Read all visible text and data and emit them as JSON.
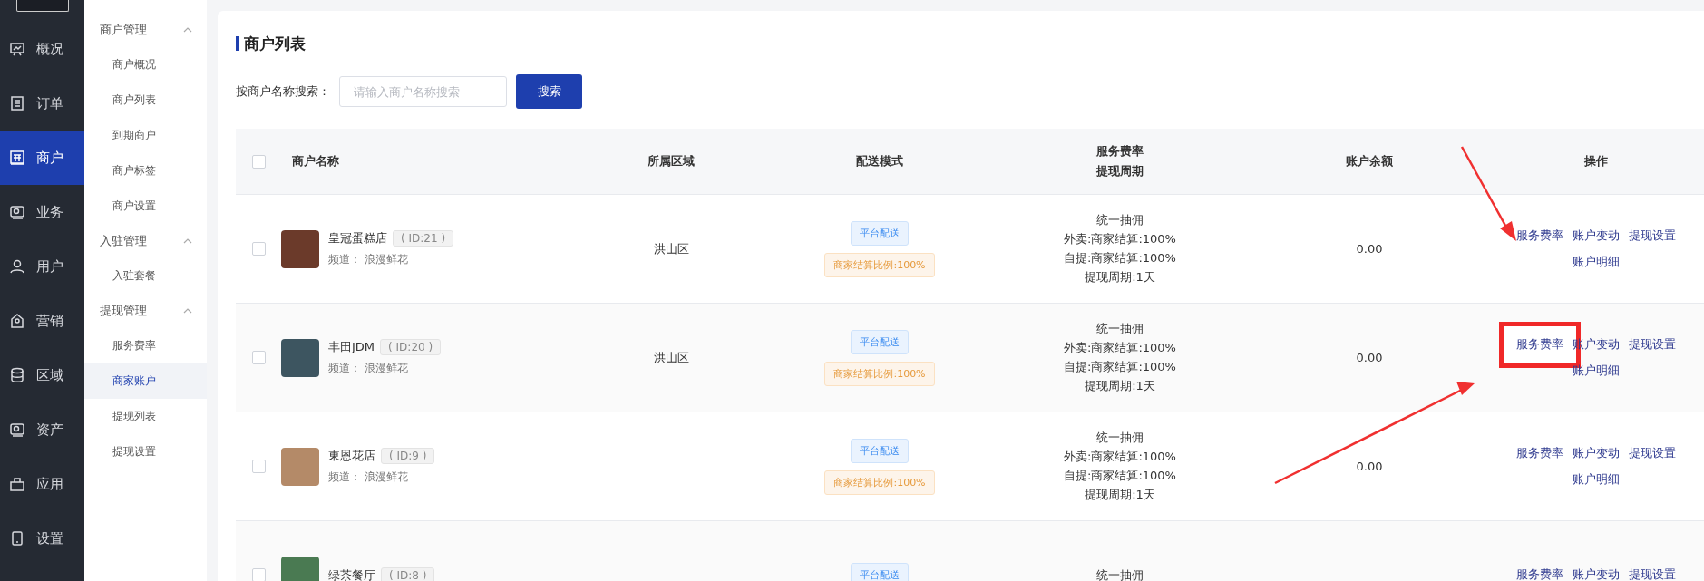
{
  "main_nav": [
    {
      "label": "概况",
      "selected": false
    },
    {
      "label": "订单",
      "selected": false
    },
    {
      "label": "商户",
      "selected": true
    },
    {
      "label": "业务",
      "selected": false
    },
    {
      "label": "用户",
      "selected": false
    },
    {
      "label": "营销",
      "selected": false
    },
    {
      "label": "区域",
      "selected": false
    },
    {
      "label": "资产",
      "selected": false
    },
    {
      "label": "应用",
      "selected": false
    },
    {
      "label": "设置",
      "selected": false
    }
  ],
  "sub_nav": [
    {
      "label": "商户管理",
      "expanded": true,
      "children": [
        {
          "label": "商户概况",
          "selected": false
        },
        {
          "label": "商户列表",
          "selected": false
        },
        {
          "label": "到期商户",
          "selected": false
        },
        {
          "label": "商户标签",
          "selected": false
        },
        {
          "label": "商户设置",
          "selected": false
        }
      ]
    },
    {
      "label": "入驻管理",
      "expanded": true,
      "children": [
        {
          "label": "入驻套餐",
          "selected": false
        }
      ]
    },
    {
      "label": "提现管理",
      "expanded": true,
      "children": [
        {
          "label": "服务费率",
          "selected": false
        },
        {
          "label": "商家账户",
          "selected": true
        },
        {
          "label": "提现列表",
          "selected": false
        },
        {
          "label": "提现设置",
          "selected": false
        }
      ]
    }
  ],
  "page_title": "商户列表",
  "search": {
    "label": "按商户名称搜索：",
    "placeholder": "请输入商户名称搜索",
    "button": "搜索"
  },
  "table": {
    "columns": [
      "商户名称",
      "所属区域",
      "配送模式",
      [
        "服务费率",
        "提现周期"
      ],
      "账户余额",
      "操作"
    ],
    "header_checked": false,
    "rows": [
      {
        "checked": false,
        "name": "皇冠蛋糕店",
        "id": "( ID:21 )",
        "channel": "频道： 浪漫鲜花",
        "region": "洪山区",
        "tags": [
          "平台配送",
          "商家结算比例:100%"
        ],
        "rates": [
          "统一抽佣",
          "外卖:商家结算:100%",
          "自提:商家结算:100%",
          "提现周期:1天"
        ],
        "balance": "0.00",
        "actions": [
          {
            "label": "服务费率",
            "highlighted": false
          },
          {
            "label": "账户变动",
            "highlighted": false
          },
          {
            "label": "提现设置",
            "highlighted": false
          },
          {
            "label": "账户明细",
            "highlighted": false
          }
        ]
      },
      {
        "checked": false,
        "name": "丰田JDM",
        "id": "( ID:20 )",
        "channel": "频道： 浪漫鲜花",
        "region": "洪山区",
        "tags": [
          "平台配送",
          "商家结算比例:100%"
        ],
        "rates": [
          "统一抽佣",
          "外卖:商家结算:100%",
          "自提:商家结算:100%",
          "提现周期:1天"
        ],
        "balance": "0.00",
        "actions": [
          {
            "label": "服务费率",
            "highlighted": true
          },
          {
            "label": "账户变动",
            "highlighted": false
          },
          {
            "label": "提现设置",
            "highlighted": false
          },
          {
            "label": "账户明细",
            "highlighted": false
          }
        ]
      },
      {
        "checked": false,
        "name": "東恩花店",
        "id": "( ID:9 )",
        "channel": "频道： 浪漫鲜花",
        "tags": [
          "平台配送",
          "商家结算比例:100%"
        ],
        "rates": [
          "统一抽佣",
          "外卖:商家结算:100%",
          "自提:商家结算:100%",
          "提现周期:1天"
        ],
        "balance": "0.00",
        "actions": [
          {
            "label": "服务费率",
            "highlighted": false
          },
          {
            "label": "账户变动",
            "highlighted": false
          },
          {
            "label": "提现设置",
            "highlighted": false
          },
          {
            "label": "账户明细",
            "highlighted": false
          }
        ]
      },
      {
        "checked": false,
        "name": "绿茶餐厅",
        "id": "( ID:8 )",
        "tags": [
          "平台配送"
        ],
        "rates": [
          "统一抽佣"
        ],
        "actions": [
          {
            "label": "服务费率",
            "highlighted": false
          },
          {
            "label": "账户变动",
            "highlighted": false
          },
          {
            "label": "提现设置",
            "highlighted": false
          }
        ]
      }
    ]
  }
}
